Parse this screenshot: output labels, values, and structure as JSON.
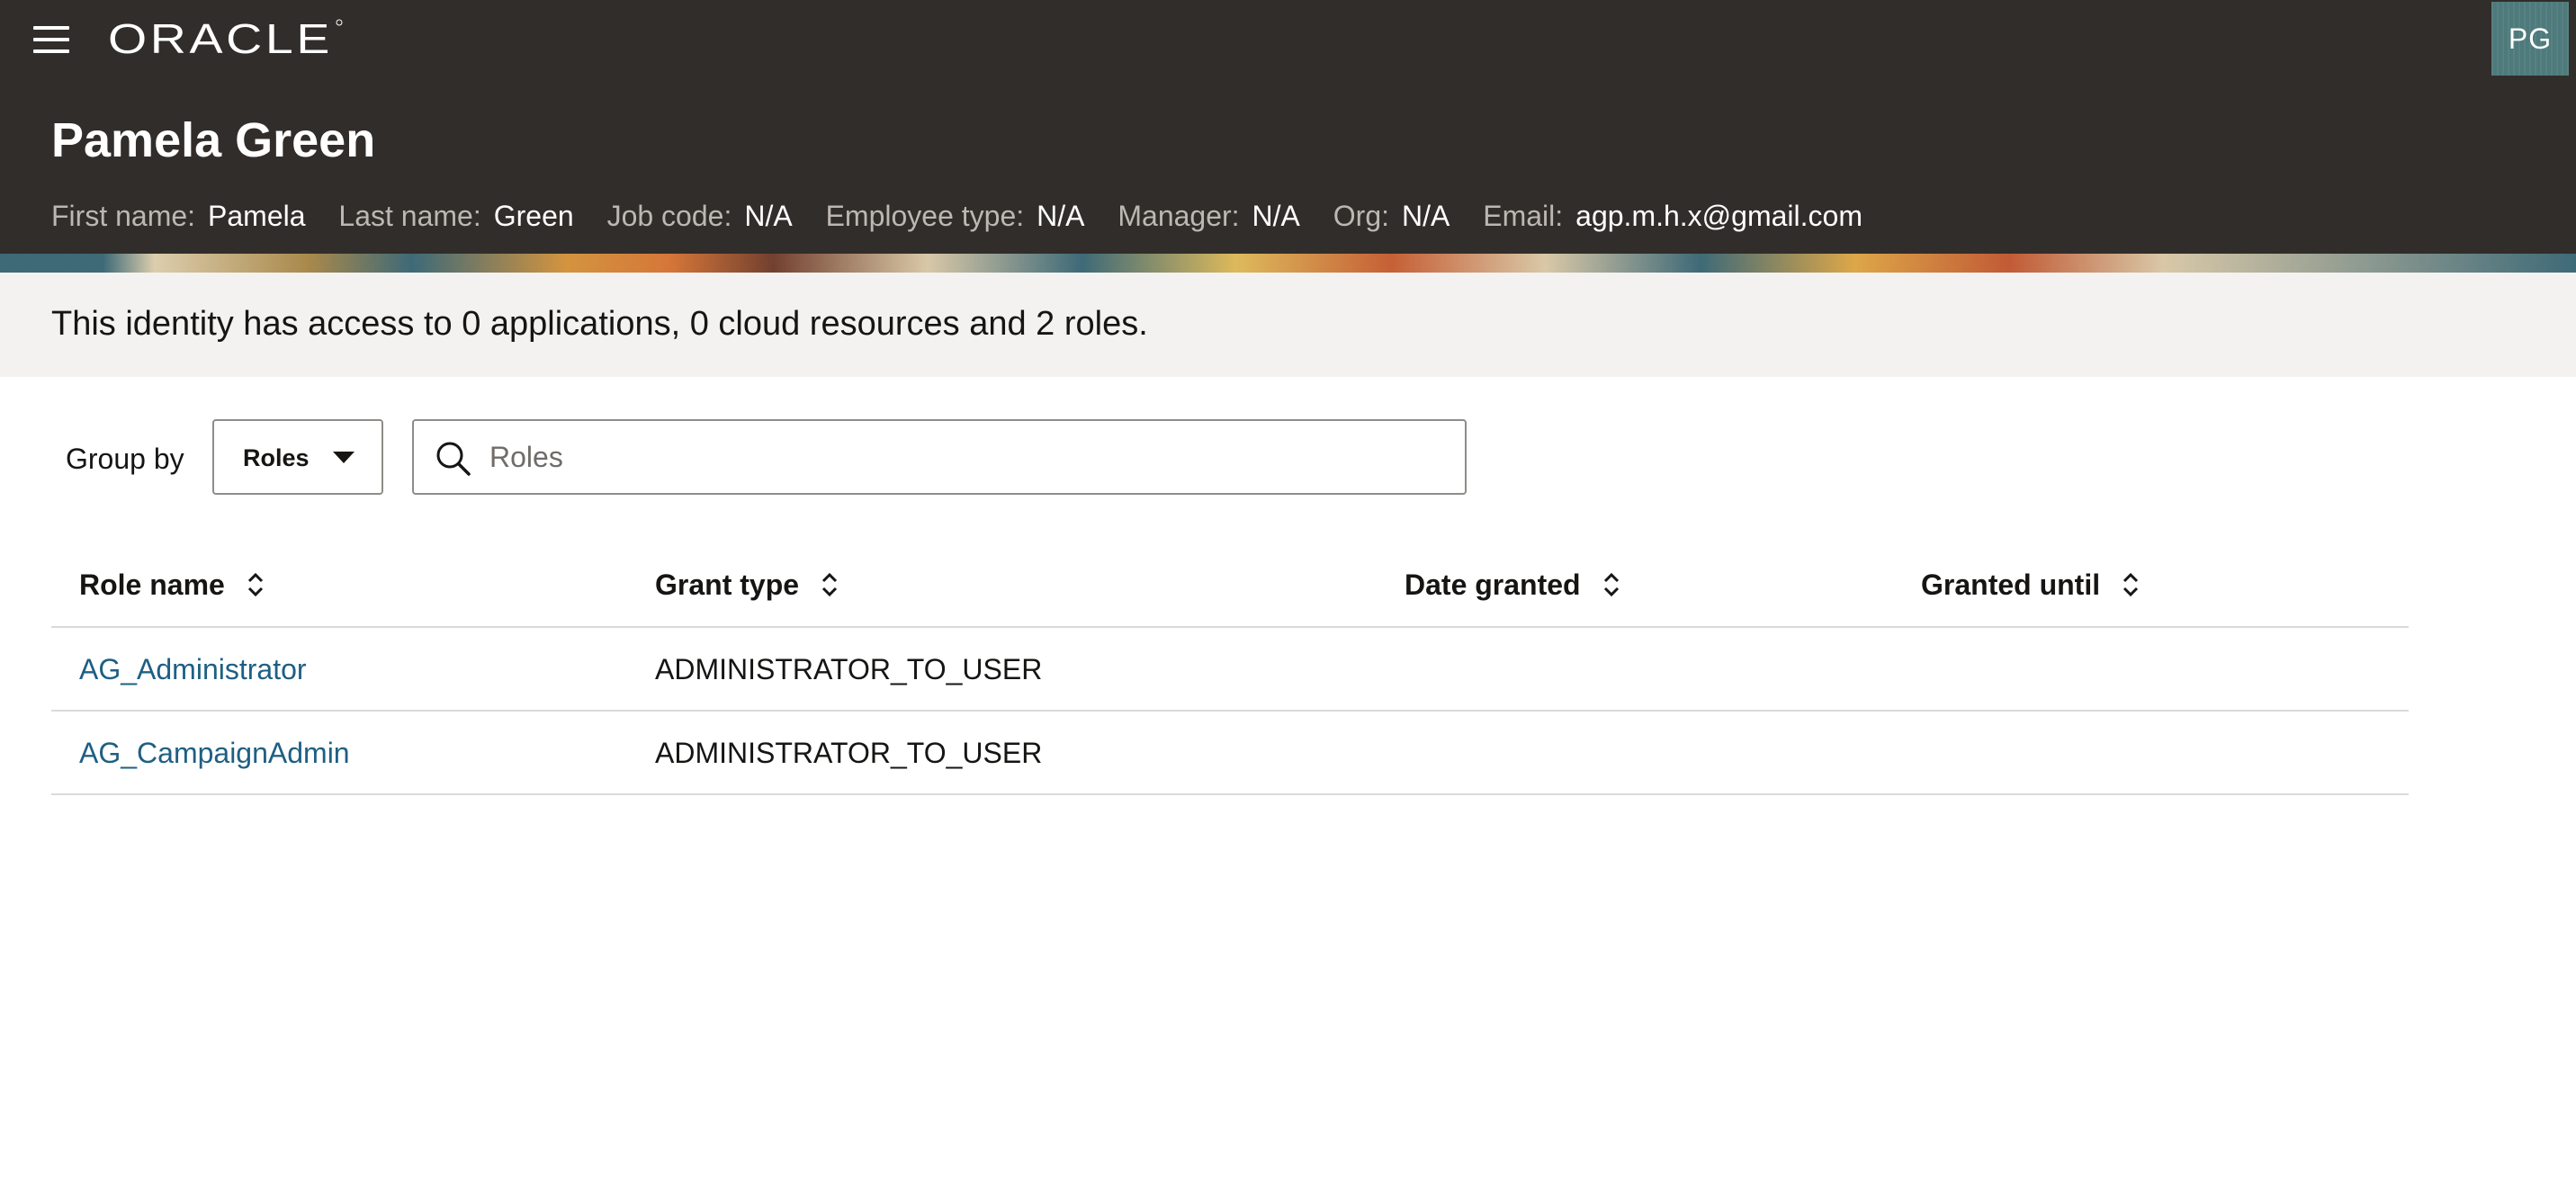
{
  "app": {
    "brand": "ORACLE",
    "user_initials": "PG"
  },
  "identity": {
    "name": "Pamela Green",
    "fields": [
      {
        "label": "First name:",
        "value": "Pamela"
      },
      {
        "label": "Last name:",
        "value": "Green"
      },
      {
        "label": "Job code:",
        "value": "N/A"
      },
      {
        "label": "Employee type:",
        "value": "N/A"
      },
      {
        "label": "Manager:",
        "value": "N/A"
      },
      {
        "label": "Org:",
        "value": "N/A"
      },
      {
        "label": "Email:",
        "value": "agp.m.h.x@gmail.com"
      }
    ]
  },
  "summary": {
    "text": "This identity has access to 0 applications, 0 cloud resources and 2 roles."
  },
  "controls": {
    "group_by_label": "Group by",
    "group_by_value": "Roles",
    "search_placeholder": "Roles",
    "search_value": ""
  },
  "table": {
    "columns": [
      "Role name",
      "Grant type",
      "Date granted",
      "Granted until"
    ],
    "rows": [
      {
        "role_name": "AG_Administrator",
        "grant_type": "ADMINISTRATOR_TO_USER",
        "date_granted": "",
        "granted_until": ""
      },
      {
        "role_name": "AG_CampaignAdmin",
        "grant_type": "ADMINISTRATOR_TO_USER",
        "date_granted": "",
        "granted_until": ""
      }
    ]
  },
  "colors": {
    "header_bg": "#312d2a",
    "summary_bg": "#f3f2f0",
    "link": "#1e5f84",
    "avatar_bg": "#4e7a7c"
  },
  "icons": [
    "hamburger-menu-icon",
    "oracle-logo",
    "search-icon",
    "chevron-down-icon",
    "sort-icon"
  ]
}
